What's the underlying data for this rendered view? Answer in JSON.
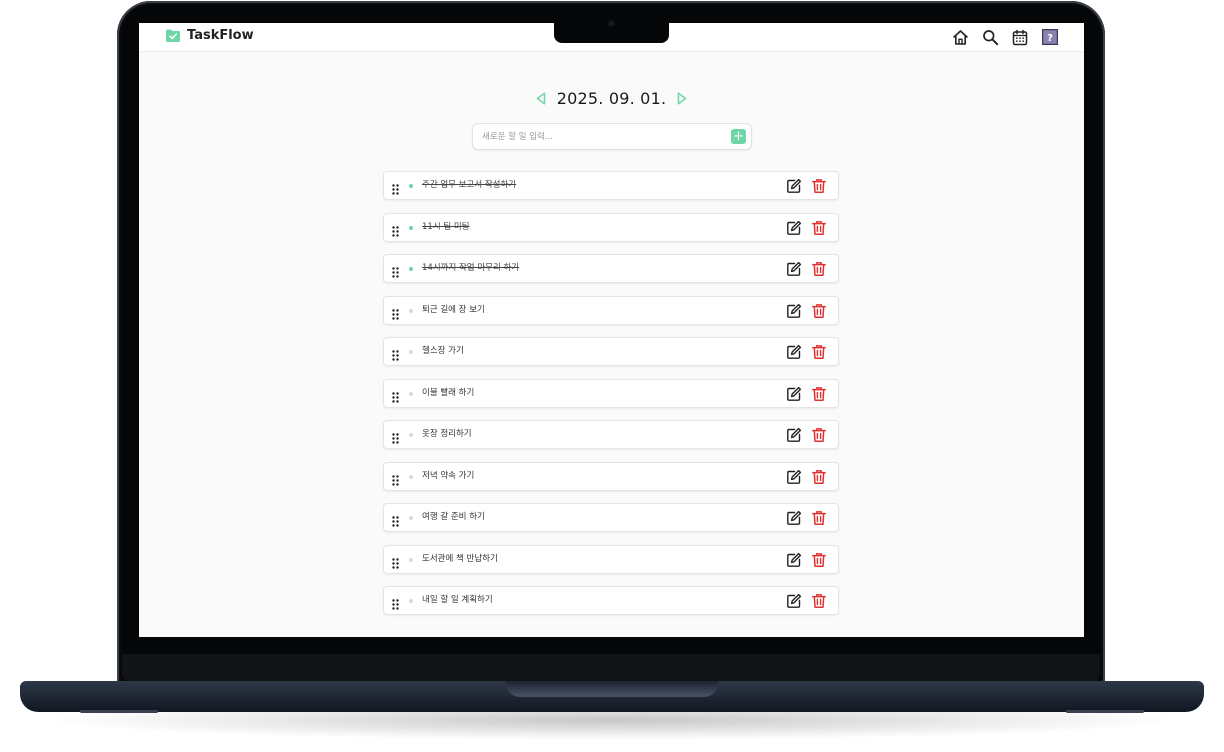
{
  "app": {
    "name": "TaskFlow"
  },
  "nav": [
    "home-icon",
    "search-icon",
    "calendar-icon",
    "help-icon"
  ],
  "date": {
    "label": "2025. 09. 01."
  },
  "add_task": {
    "placeholder": "새로운 할 일 입력...",
    "value": "",
    "button": "+"
  },
  "tasks": [
    {
      "text": "주간 업무 보고서 작성하기",
      "done": true
    },
    {
      "text": "11시 팀 미팅",
      "done": true
    },
    {
      "text": "14시까지 작업 마무리 하기",
      "done": true
    },
    {
      "text": "퇴근 길에 장 보기",
      "done": false
    },
    {
      "text": "헬스장 가기",
      "done": false
    },
    {
      "text": "이불 빨래 하기",
      "done": false
    },
    {
      "text": "옷장 정리하기",
      "done": false
    },
    {
      "text": "저녁 약속 가기",
      "done": false
    },
    {
      "text": "여행 갈 준비 하기",
      "done": false
    },
    {
      "text": "도서관에 책 반납하기",
      "done": false
    },
    {
      "text": "내일 할 일 계획하기",
      "done": false
    }
  ],
  "colors": {
    "accent": "#6ed6a6",
    "delete": "#e03131",
    "done_dot": "#6ed6a6",
    "pending_dot": "#d9d9d9"
  }
}
